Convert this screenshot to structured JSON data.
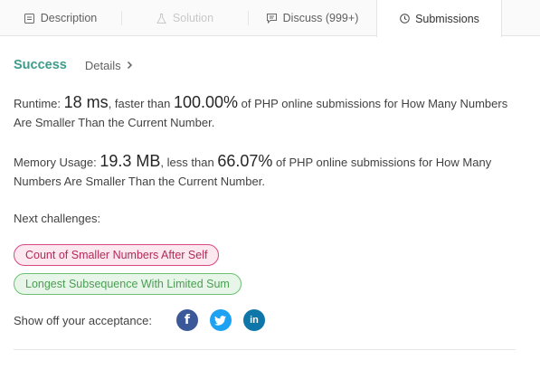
{
  "tabs": [
    {
      "label": "Description",
      "icon": "document-icon"
    },
    {
      "label": "Solution",
      "icon": "flask-icon"
    },
    {
      "label": "Discuss (999+)",
      "icon": "chat-icon"
    },
    {
      "label": "Submissions",
      "icon": "clock-icon"
    }
  ],
  "result": {
    "status": "Success",
    "details_label": "Details"
  },
  "runtime": {
    "label": "Runtime:",
    "value": "18 ms",
    "comparison": ", faster than",
    "percent": "100.00%",
    "suffix": "of PHP online submissions for How Many Numbers Are Smaller Than the Current Number."
  },
  "memory": {
    "label": "Memory Usage:",
    "value": "19.3 MB",
    "comparison": ", less than",
    "percent": "66.07%",
    "suffix": "of PHP online submissions for How Many Numbers Are Smaller Than the Current Number."
  },
  "next_challenges": {
    "label": "Next challenges:",
    "items": [
      {
        "title": "Count of Smaller Numbers After Self",
        "difficulty_color": "#d64881"
      },
      {
        "title": "Longest Subsequence With Limited Sum",
        "difficulty_color": "#69c06f"
      }
    ]
  },
  "share": {
    "label": "Show off your acceptance:",
    "buttons": [
      {
        "icon": "facebook-icon",
        "glyph": "f",
        "color": "#3b5998"
      },
      {
        "icon": "twitter-icon",
        "color": "#1da1f2"
      },
      {
        "icon": "linkedin-icon",
        "glyph": "in",
        "color": "#0e76a8"
      }
    ]
  }
}
